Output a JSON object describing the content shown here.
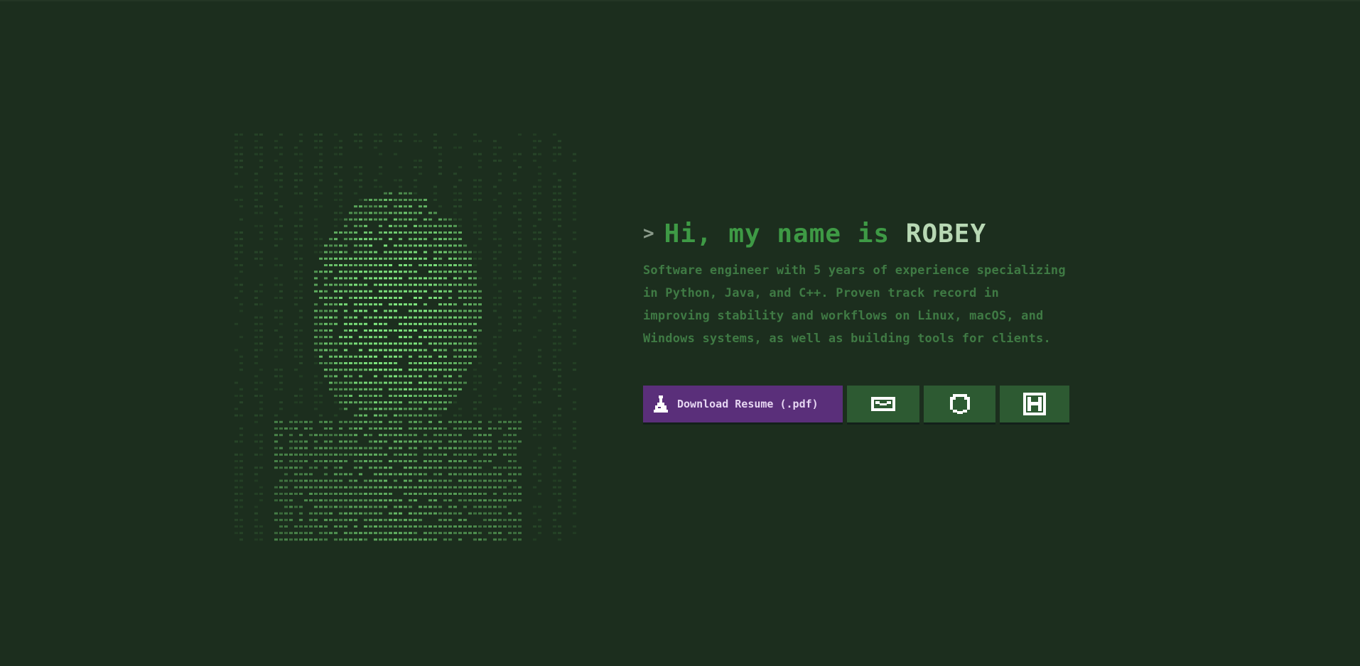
{
  "hero": {
    "prompt_symbol": ">",
    "greeting": "Hi, my name is",
    "name": "ROBEY",
    "bio": "Software engineer with 5 years of experience specializing in Python, Java, and C++. Proven track record in improving stability and workflows on Linux, macOS, and Windows systems, as well as building tools for clients."
  },
  "actions": {
    "primary_label": "Download Resume (.pdf)",
    "icons": [
      "email-icon",
      "github-icon",
      "linkedin-icon"
    ]
  },
  "colors": {
    "background": "#1c2e1e",
    "accent_green": "#3e9a45",
    "button_green": "#2d5a32",
    "button_purple": "#5a2f7a"
  }
}
